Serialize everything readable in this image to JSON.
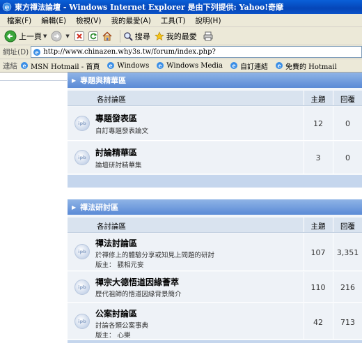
{
  "window": {
    "title": "東方禪法論壇 - Windows Internet Explorer 是由下列提供: Yahoo!奇摩"
  },
  "menu": [
    "檔案(F)",
    "編輯(E)",
    "檢視(V)",
    "我的最愛(A)",
    "工具(T)",
    "說明(H)"
  ],
  "toolbar": {
    "back_label": "上一頁",
    "search_label": "搜尋",
    "favorites_label": "我的最愛"
  },
  "address": {
    "label": "網址(D)",
    "url": "http://www.chinazen.why3s.tw/forum/index.php?"
  },
  "links": {
    "label": "連結",
    "items": [
      "MSN Hotmail - 首頁",
      "Windows",
      "Windows Media",
      "自訂連結",
      "免費的 Hotmail"
    ]
  },
  "categories": [
    {
      "title": "專題與精華區",
      "columns": {
        "name": "各討論區",
        "topics": "主題",
        "replies": "回覆"
      },
      "forums": [
        {
          "name": "專題發表區",
          "desc": "自訂專題發表論文",
          "moderator": "",
          "topics": "12",
          "replies": "0"
        },
        {
          "name": "討論精華區",
          "desc": "論壇研討精華集",
          "moderator": "",
          "topics": "3",
          "replies": "0"
        }
      ]
    },
    {
      "title": "禪法研討區",
      "columns": {
        "name": "各討論區",
        "topics": "主題",
        "replies": "回覆"
      },
      "forums": [
        {
          "name": "禪法討論區",
          "desc": "於禪修上的體驗分享或知見上問題的研討",
          "moderator": "版主： 觀相元妄",
          "topics": "107",
          "replies": "3,351"
        },
        {
          "name": "禪宗大德悟道因緣薈萃",
          "desc": "歷代祖師的悟道因緣背景簡介",
          "moderator": "",
          "topics": "110",
          "replies": "216"
        },
        {
          "name": "公案討論區",
          "desc": "討論各類公案事典",
          "moderator": "版主： 心樂",
          "topics": "42",
          "replies": "713"
        }
      ]
    }
  ],
  "row_icon_text": "ipb"
}
